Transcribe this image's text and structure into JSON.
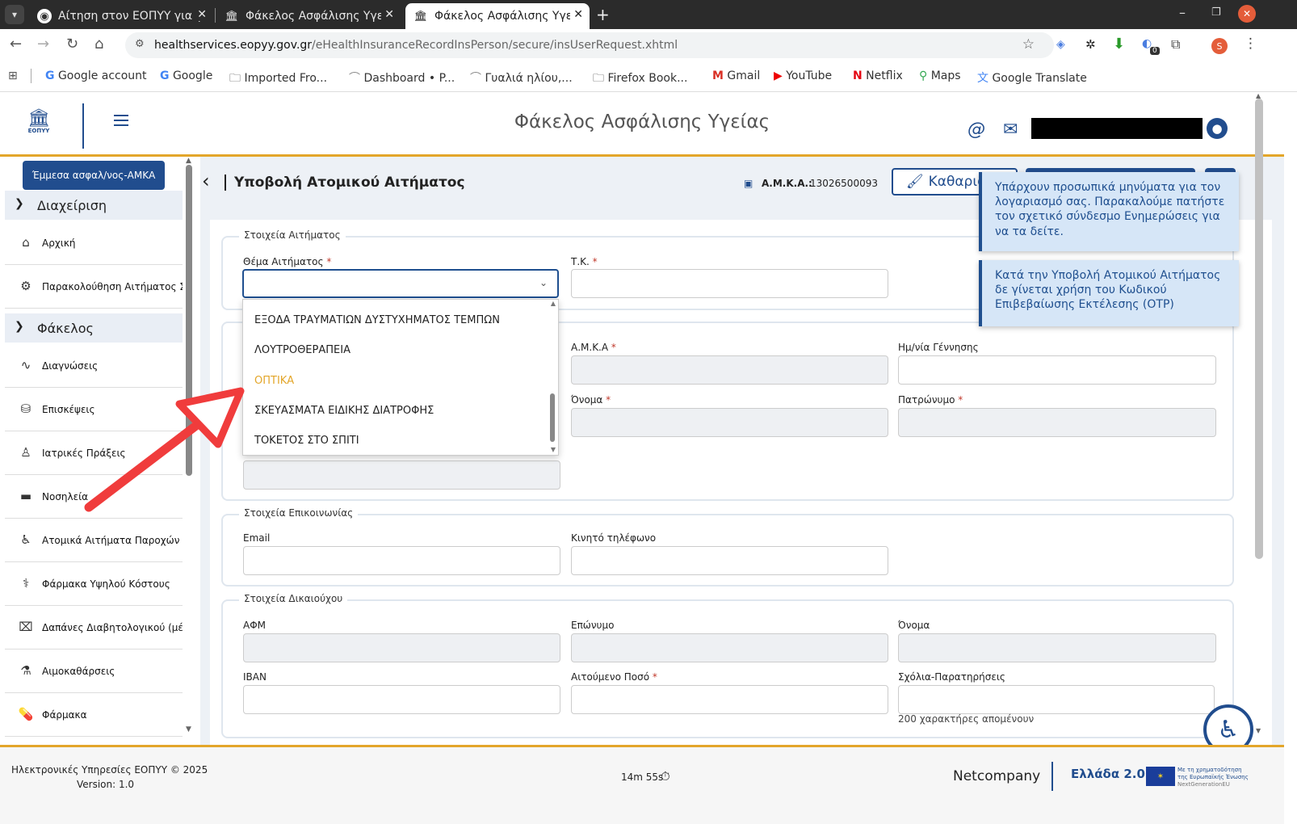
{
  "browser": {
    "tabs": [
      {
        "label": "Αίτηση στον ΕΟΠΥΥ για γ",
        "close": "✕"
      },
      {
        "label": "Φάκελος Ασφάλισης Υγε",
        "close": "✕"
      },
      {
        "label": "Φάκελος Ασφάλισης Υγε",
        "close": "✕"
      }
    ],
    "new_tab": "+",
    "url_domain": "healthservices.eopyy.gov.gr",
    "url_path": "/eHealthInsuranceRecordInsPerson/secure/insUserRequest.xhtml",
    "extension_badge": "0",
    "profile_initial": "S",
    "bookmarks": [
      "Google account",
      "Google",
      "Imported Fro...",
      "Dashboard • P...",
      "Γυαλιά ηλίου,...",
      "Firefox Book...",
      "Gmail",
      "YouTube",
      "Netflix",
      "Maps",
      "Google Translate"
    ]
  },
  "header": {
    "logo_text": "ΕΟΠΥΥ",
    "title": "Φάκελος Ασφάλισης Υγείας"
  },
  "sidebar": {
    "emmesa_button": "Έμμεσα ασφαλ/νος-ΑΜΚΑ",
    "group1": "Διαχείριση",
    "group1_items": [
      "Αρχική",
      "Παρακολούθηση Αιτήματος Σ.Η."
    ],
    "group2": "Φάκελος",
    "group2_items": [
      "Διαγνώσεις",
      "Επισκέψεις",
      "Ιατρικές Πράξεις",
      "Νοσηλεία",
      "Ατομικά Αιτήματα Παροχών",
      "Φάρμακα Υψηλού Κόστους",
      "Δαπάνες Διαβητολογικού (μέχρι",
      "Αιμοκαθάρσεις",
      "Φάρμακα"
    ]
  },
  "page": {
    "back": "‹",
    "title": "Υποβολή Ατομικού Αιτήματος",
    "amka_label": "Α.Μ.Κ.Α.:",
    "amka_value": "13026500093",
    "clear_button": "Καθαρισ"
  },
  "form": {
    "sec_request": "Στοιχεία Αιτήματος",
    "subject_label": "Θέμα Αιτήματος",
    "tk_label": "Τ.Κ.",
    "amka_label": "Α.Μ.Κ.Α",
    "birth_label": "Ημ/νία Γέννησης",
    "name_label": "Όνομα",
    "father_label": "Πατρώνυμο",
    "required_mark": "*",
    "sec_contact": "Στοιχεία Επικοινωνίας",
    "email_label": "Email",
    "mobile_label": "Κινητό τηλέφωνο",
    "sec_beneficiary": "Στοιχεία Δικαιούχου",
    "afm_label": "ΑΦΜ",
    "surname_label": "Επώνυμο",
    "name2_label": "Όνομα",
    "iban_label": "IBAN",
    "amount_label": "Αιτούμενο Ποσό",
    "comments_label": "Σχόλια-Παρατηρήσεις",
    "chars_left": "200 χαρακτήρες απομένουν"
  },
  "dropdown_options": [
    "ΕΞΟΔΑ ΤΡΑΥΜΑΤΙΩΝ ΔΥΣΤΥΧΗΜΑΤΟΣ ΤΕΜΠΩΝ",
    "ΛΟΥΤΡΟΘΕΡΑΠΕΙΑ",
    "ΟΠΤΙΚΑ",
    "ΣΚΕΥΑΣΜΑΤΑ ΕΙΔΙΚΗΣ ΔΙΑΤΡΟΦΗΣ",
    "ΤΟΚΕΤΟΣ ΣΤΟ ΣΠΙΤΙ"
  ],
  "notifications": [
    "Υπάρχουν προσωπικά μηνύματα για τον λογαριασμό σας. Παρακαλούμε πατήστε τον σχετικό σύνδεσμο Ενημερώσεις για να τα δείτε.",
    "Κατά την Υποβολή Ατομικού Αιτήματος δε γίνεται χρήση του Κωδικού Επιβεβαίωσης Εκτέλεσης (OTP)"
  ],
  "footer": {
    "copyright": "Ηλεκτρονικές Υπηρεσίες ΕΟΠΥΥ © 2025",
    "version": "Version: 1.0",
    "timer": "14m 55s",
    "netcompany": "Netcompany",
    "greece20": "Ελλάδα 2.0",
    "eu_text_1": "Με τη χρηματοδότηση",
    "eu_text_2": "της Ευρωπαϊκής Ένωσης",
    "eu_text_3": "NextGenerationEU"
  },
  "colors": {
    "accent": "#e3a62a",
    "primary": "#214d8e",
    "annotation_arrow": "#f03c3c"
  }
}
